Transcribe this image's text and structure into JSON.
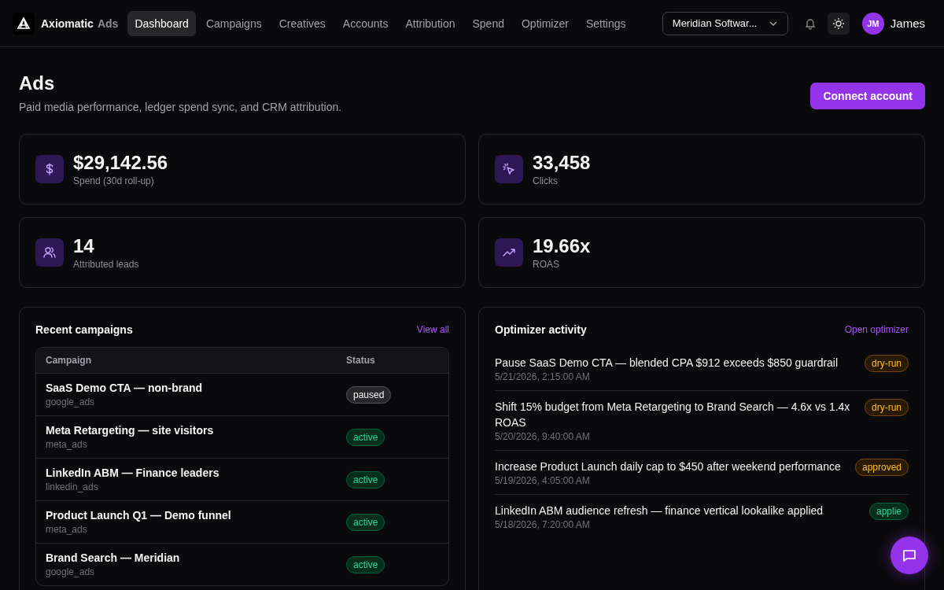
{
  "brand": {
    "name": "Axiomatic",
    "suffix": "Ads"
  },
  "nav": [
    {
      "label": "Dashboard",
      "selected": true
    },
    {
      "label": "Campaigns",
      "selected": false
    },
    {
      "label": "Creatives",
      "selected": false
    },
    {
      "label": "Accounts",
      "selected": false
    },
    {
      "label": "Attribution",
      "selected": false
    },
    {
      "label": "Spend",
      "selected": false
    },
    {
      "label": "Optimizer",
      "selected": false
    },
    {
      "label": "Settings",
      "selected": false
    }
  ],
  "workspace_select": {
    "value": "Meridian Softwar..."
  },
  "user": {
    "initials": "JM",
    "name": "James"
  },
  "page": {
    "title": "Ads",
    "subtitle": "Paid media performance, ledger spend sync, and CRM attribution.",
    "action": "Connect account"
  },
  "stats": [
    {
      "kind": "dollar",
      "value": "$29,142.56",
      "label": "Spend (30d roll-up)"
    },
    {
      "kind": "cursor",
      "value": "33,458",
      "label": "Clicks"
    },
    {
      "kind": "users",
      "value": "14",
      "label": "Attributed leads"
    },
    {
      "kind": "trend",
      "value": "19.66x",
      "label": "ROAS"
    }
  ],
  "recent_campaigns": {
    "title": "Recent campaigns",
    "link": "View all",
    "columns": [
      "Campaign",
      "Status"
    ],
    "rows": [
      {
        "name": "SaaS Demo CTA — non-brand",
        "source": "google_ads",
        "status": "paused",
        "kind": "neutral"
      },
      {
        "name": "Meta Retargeting — site visitors",
        "source": "meta_ads",
        "status": "active",
        "kind": "success"
      },
      {
        "name": "LinkedIn ABM — Finance leaders",
        "source": "linkedin_ads",
        "status": "active",
        "kind": "success"
      },
      {
        "name": "Product Launch Q1 — Demo funnel",
        "source": "meta_ads",
        "status": "active",
        "kind": "success"
      },
      {
        "name": "Brand Search — Meridian",
        "source": "google_ads",
        "status": "active",
        "kind": "success"
      }
    ]
  },
  "optimizer_activity": {
    "title": "Optimizer activity",
    "link": "Open optimizer",
    "items": [
      {
        "text": "Pause SaaS Demo CTA — blended CPA $912 exceeds $850 guardrail",
        "time": "5/21/2026, 2:15:00 AM",
        "status": "dry-run",
        "kind": "warning"
      },
      {
        "text": "Shift 15% budget from Meta Retargeting to Brand Search — 4.6x vs 1.4x ROAS",
        "time": "5/20/2026, 9:40:00 AM",
        "status": "dry-run",
        "kind": "warning"
      },
      {
        "text": "Increase Product Launch daily cap to $450 after weekend performance",
        "time": "5/19/2026, 4:05:00 AM",
        "status": "approved",
        "kind": "warning"
      },
      {
        "text": "LinkedIn ABM audience refresh — finance vertical lookalike applied",
        "time": "5/18/2026, 7:20:00 AM",
        "status": "applie",
        "kind": "success"
      }
    ]
  }
}
